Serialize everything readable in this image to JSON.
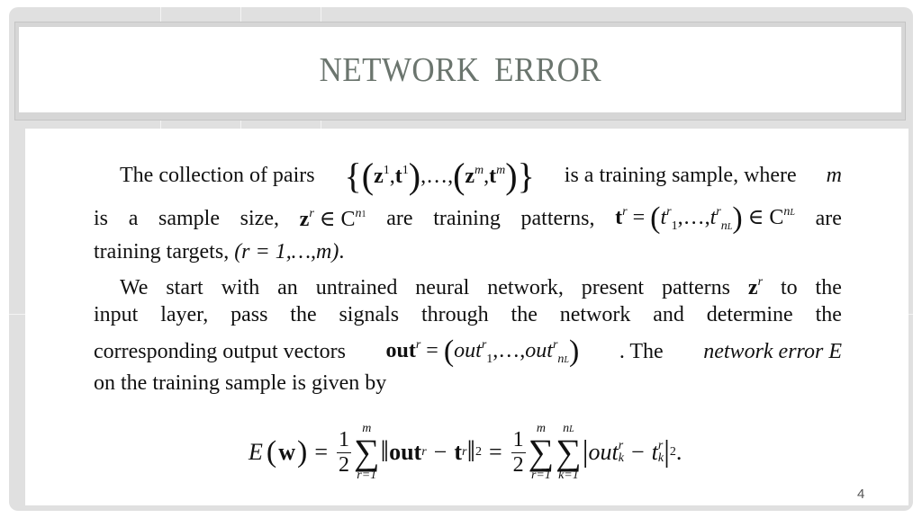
{
  "slide": {
    "title": "NETWORK  ERROR",
    "page_number": "4",
    "colors": {
      "title": "#6b756e",
      "frame": "#e0e0e0",
      "text": "#111111"
    }
  },
  "body": {
    "p1_l1_a": "The collection of pairs",
    "p1_set": {
      "open": "{(",
      "z1": "z",
      "sup1": "1",
      "comma": ",",
      "t1": "t",
      "sup1b": "1",
      "mid": "),…,(",
      "zm": "z",
      "supm": "m",
      "tm": "t",
      "supmb": "m",
      "close": ")}"
    },
    "p1_l1_b": "is a training sample, where",
    "p1_l1_m": "m",
    "p1_l2": [
      "is",
      "a",
      "sample",
      "size,"
    ],
    "p1_l2_math1": {
      "z": "z",
      "sup": "r",
      "in": "∈ C",
      "exp": "n",
      "exp_sub": "1"
    },
    "p1_l2_mid": [
      "are",
      "training",
      "patterns,"
    ],
    "p1_l2_math2": {
      "t": "t",
      "sup": "r",
      "eq": " = (",
      "tt": "t",
      "s1": "1",
      "sr": "r",
      "dots": ",…,",
      "tt2": "t",
      "sr2": "r",
      "snl": "n",
      "snl_sub": "L",
      "close": ") ∈ C",
      "exp": "n",
      "exp_sub": "L"
    },
    "p1_l2_end": "are",
    "p1_l3_a": "training targets,",
    "p1_l3_math": "(r = 1,…,m)",
    "p1_l3_end": ".",
    "p2_l1": [
      "We",
      "start",
      "with",
      "an",
      "untrained",
      "neural",
      "network,",
      "present",
      "patterns"
    ],
    "p2_l1_z": {
      "z": "z",
      "sup": "r"
    },
    "p2_l1_end": [
      "to",
      "the"
    ],
    "p2_l2": [
      "input",
      "layer,",
      "pass",
      "the",
      "signals",
      "through",
      "the",
      "network",
      "and",
      "determine",
      "the"
    ],
    "p2_l3_a": "corresponding output vectors",
    "p2_l3_math": {
      "out": "out",
      "sup": "r",
      "eq": " = (",
      "o1": "out",
      "o1sup": "r",
      "o1sub": "1",
      "dots": ",…,",
      "o2": "out",
      "o2sup": "r",
      "o2sub": "n",
      "o2subsub": "L",
      "close": ")"
    },
    "p2_l3_b": ". The",
    "p2_l3_italic": "network error E",
    "p2_l4": "on the training sample is given by"
  },
  "formula": {
    "lhs": "E",
    "arg": "(w)",
    "eq1": "=",
    "half_num": "1",
    "half_den": "2",
    "sum1_upper": "m",
    "sum1_lower": "r=1",
    "sigma": "∑",
    "norm_l": "‖",
    "out": "out",
    "out_sup": "r",
    "minus": "−",
    "t": "t",
    "t_sup": "r",
    "norm_r": "‖",
    "sq": "2",
    "eq2": "=",
    "sum2_upper": "m",
    "sum2_lower": "r=1",
    "sum3_upper": "n",
    "sum3_upper_sub": "L",
    "sum3_lower": "k=1",
    "abs_l": "|",
    "outk": "out",
    "outk_sup": "r",
    "outk_sub": "k",
    "tk": "t",
    "tk_sup": "r",
    "tk_sub": "k",
    "abs_r": "|",
    "sq2": "2",
    "end": "."
  }
}
